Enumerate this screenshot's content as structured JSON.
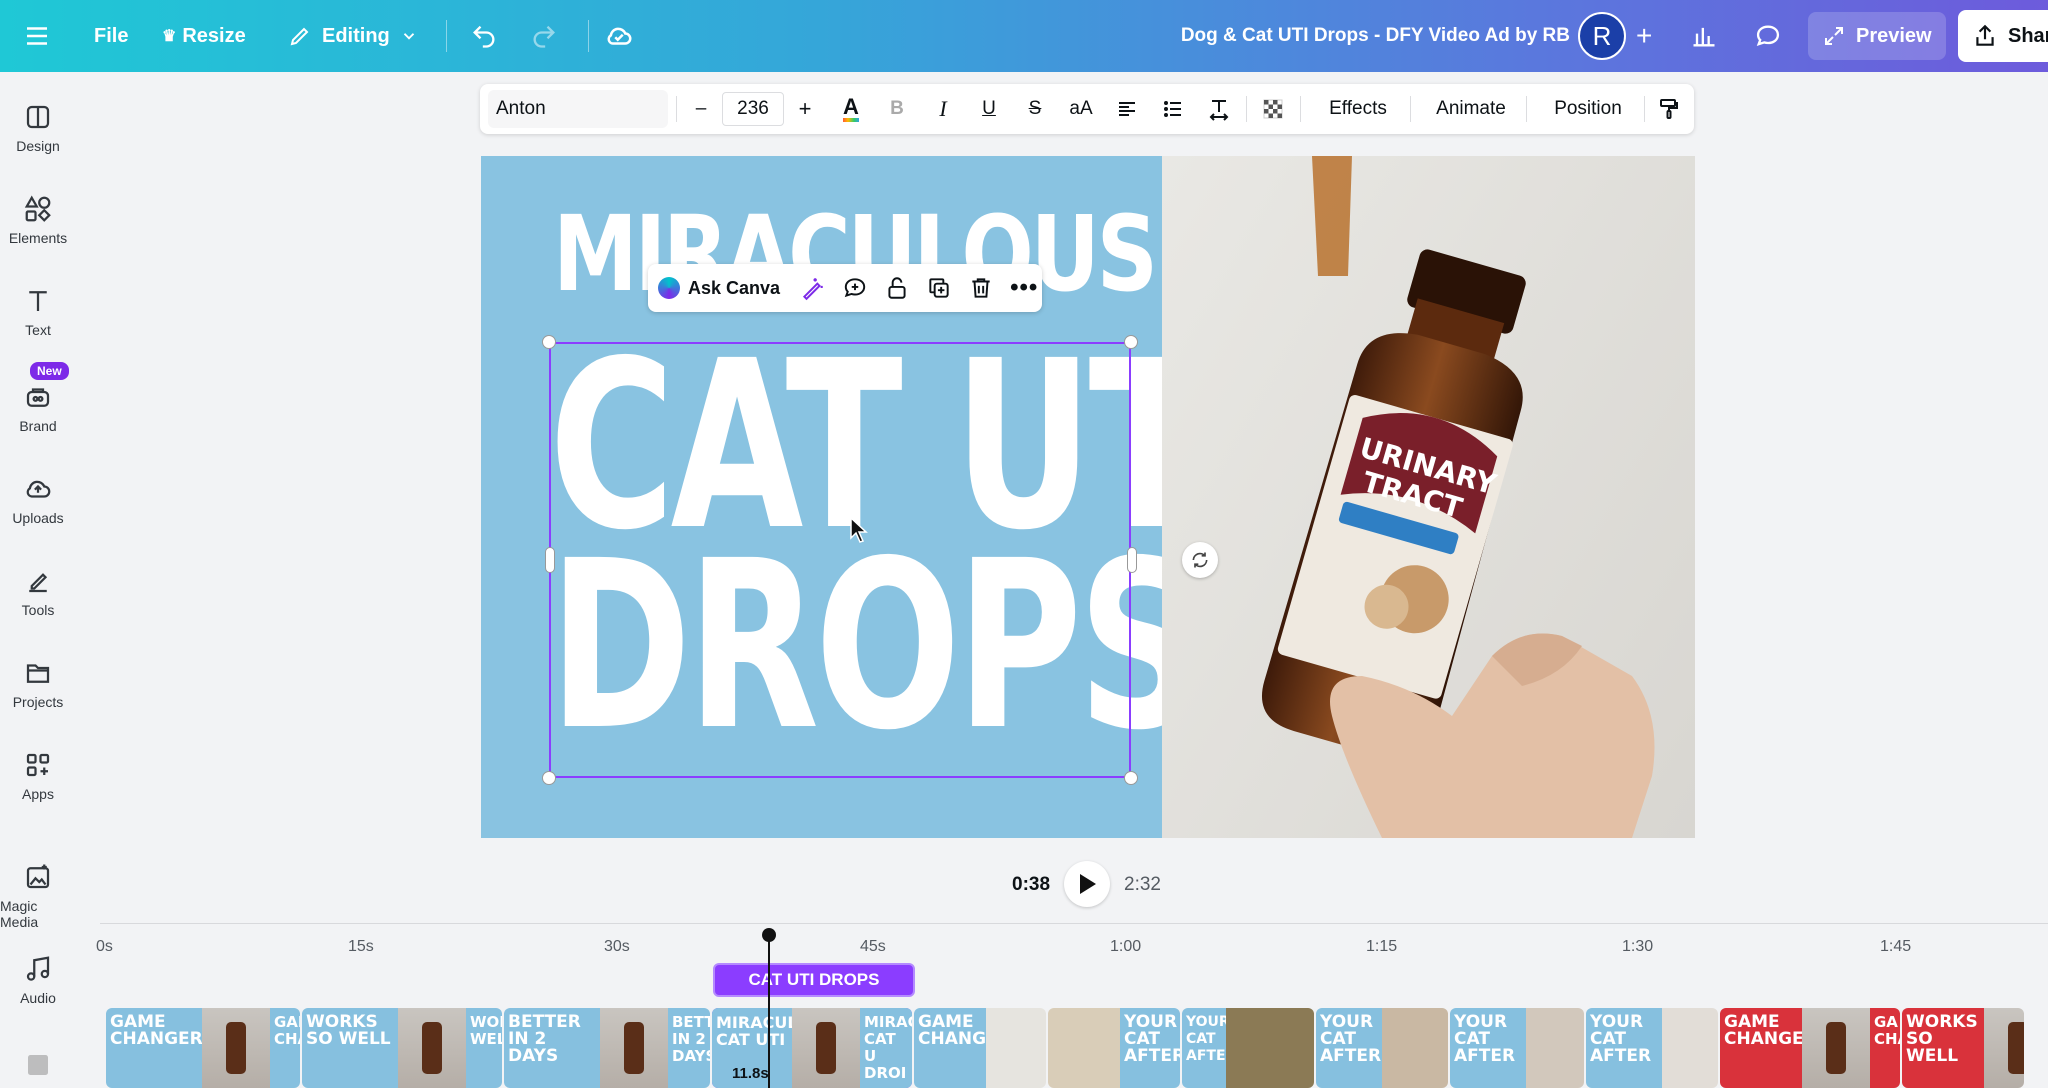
{
  "topbar": {
    "file_label": "File",
    "resize_label": "Resize",
    "editing_label": "Editing",
    "doc_title": "Dog & Cat UTI Drops - DFY Video Ad by RB",
    "avatar_initial": "R",
    "preview_label": "Preview",
    "share_label": "Share"
  },
  "sidebar": {
    "items": [
      {
        "label": "Design",
        "icon": "design-icon"
      },
      {
        "label": "Elements",
        "icon": "elements-icon"
      },
      {
        "label": "Text",
        "icon": "text-icon"
      },
      {
        "label": "Brand",
        "icon": "brand-icon"
      },
      {
        "label": "Uploads",
        "icon": "uploads-icon"
      },
      {
        "label": "Tools",
        "icon": "tools-icon"
      },
      {
        "label": "Projects",
        "icon": "projects-icon"
      },
      {
        "label": "Apps",
        "icon": "apps-icon"
      },
      {
        "label": "Magic Media",
        "icon": "magic-media-icon"
      },
      {
        "label": "Audio",
        "icon": "audio-icon"
      }
    ],
    "new_badge": "New"
  },
  "text_toolbar": {
    "font": "Anton",
    "font_size": "236",
    "minus": "–",
    "plus": "+",
    "case_label": "aA",
    "effects_label": "Effects",
    "animate_label": "Animate",
    "position_label": "Position"
  },
  "canvas": {
    "small_heading": "MIRACULOUS",
    "headline_line1": "CAT UTI",
    "headline_line2": "DROPS",
    "ask_canva_label": "Ask Canva",
    "bottle_label_line1": "URINARY",
    "bottle_label_line2": "TRACT"
  },
  "playback": {
    "current_time": "0:38",
    "total_time": "2:32"
  },
  "timeline": {
    "ticks": [
      "0s",
      "15s",
      "30s",
      "45s",
      "1:00",
      "1:15",
      "1:30",
      "1:45"
    ],
    "text_clip_label": "CAT UTI DROPS",
    "selected_clip_duration": "11.8s",
    "clips": [
      [
        "GAME CHANGER",
        "",
        "GAM CHANG"
      ],
      [
        "WORKS SO WELL",
        "",
        "WORKS WELL"
      ],
      [
        "BETTER IN 2 DAYS",
        "",
        "BETTE IN 2 DAYS"
      ],
      [
        "MIRACULOUS CAT UTI",
        "",
        "MIRACU CAT U DROI"
      ],
      [
        "GAME CHANGER",
        ""
      ],
      [
        "",
        "YOUR CAT AFTER"
      ],
      [
        "YOUR CAT AFTER",
        ""
      ],
      [
        "YOUR CAT AFTER",
        ""
      ],
      [
        "YOUR CAT AFTER",
        ""
      ],
      [
        "YOUR CAT AFTER",
        ""
      ],
      [
        "GAME CHANGER",
        "",
        "GA CHA"
      ],
      [
        "WORKS SO WELL",
        ""
      ]
    ]
  },
  "colors": {
    "accent_purple": "#8b3dff",
    "canvas_bg": "#89c3e1",
    "clip_red": "#d9323b",
    "clip_blue": "#86c0df"
  }
}
